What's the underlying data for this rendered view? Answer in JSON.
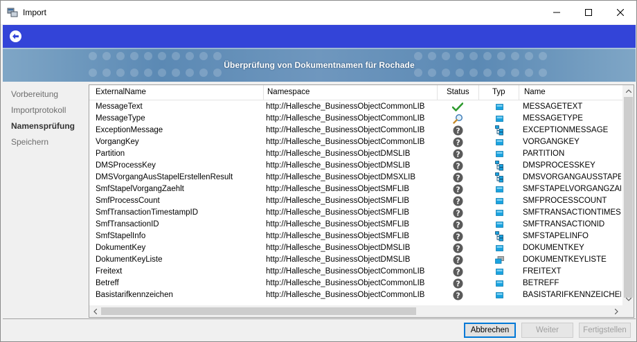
{
  "window": {
    "title": "Import"
  },
  "banner": {
    "title": "Überprüfung von Dokumentnamen für Rochade"
  },
  "nav": {
    "items": [
      {
        "label": "Vorbereitung",
        "active": false
      },
      {
        "label": "Importprotokoll",
        "active": false
      },
      {
        "label": "Namensprüfung",
        "active": true
      },
      {
        "label": "Speichern",
        "active": false
      }
    ]
  },
  "table": {
    "columns": [
      "ExternalName",
      "Namespace",
      "Status",
      "Typ",
      "Name"
    ],
    "rows": [
      {
        "external_name": "MessageText",
        "namespace": "http://Hallesche_BusinessObjectCommonLIB",
        "status": "ok-check",
        "typ": "field",
        "name": "MESSAGETEXT"
      },
      {
        "external_name": "MessageType",
        "namespace": "http://Hallesche_BusinessObjectCommonLIB",
        "status": "search",
        "typ": "field",
        "name": "MESSAGETYPE"
      },
      {
        "external_name": "ExceptionMessage",
        "namespace": "http://Hallesche_BusinessObjectCommonLIB",
        "status": "unknown",
        "typ": "structure",
        "name": "EXCEPTIONMESSAGE"
      },
      {
        "external_name": "VorgangKey",
        "namespace": "http://Hallesche_BusinessObjectCommonLIB",
        "status": "unknown",
        "typ": "field",
        "name": "VORGANGKEY"
      },
      {
        "external_name": "Partition",
        "namespace": "http://Hallesche_BusinessObjectDMSLIB",
        "status": "unknown",
        "typ": "field",
        "name": "PARTITION"
      },
      {
        "external_name": "DMSProcessKey",
        "namespace": "http://Hallesche_BusinessObjectDMSLIB",
        "status": "unknown",
        "typ": "structure",
        "name": "DMSPROCESSKEY"
      },
      {
        "external_name": "DMSVorgangAusStapelErstellenResult",
        "namespace": "http://Hallesche_BusinessObjectDMSXLIB",
        "status": "unknown",
        "typ": "structure",
        "name": "DMSVORGANGAUSSTAPELI"
      },
      {
        "external_name": "SmfStapelVorgangZaehlt",
        "namespace": "http://Hallesche_BusinessObjectSMFLIB",
        "status": "unknown",
        "typ": "field",
        "name": "SMFSTAPELVORGANGZAEH"
      },
      {
        "external_name": "SmfProcessCount",
        "namespace": "http://Hallesche_BusinessObjectSMFLIB",
        "status": "unknown",
        "typ": "field",
        "name": "SMFPROCESSCOUNT"
      },
      {
        "external_name": "SmfTransactionTimestampID",
        "namespace": "http://Hallesche_BusinessObjectSMFLIB",
        "status": "unknown",
        "typ": "field",
        "name": "SMFTRANSACTIONTIMESTA"
      },
      {
        "external_name": "SmfTransactionID",
        "namespace": "http://Hallesche_BusinessObjectSMFLIB",
        "status": "unknown",
        "typ": "field",
        "name": "SMFTRANSACTIONID"
      },
      {
        "external_name": "SmfStapelInfo",
        "namespace": "http://Hallesche_BusinessObjectSMFLIB",
        "status": "unknown",
        "typ": "structure",
        "name": "SMFSTAPELINFO"
      },
      {
        "external_name": "DokumentKey",
        "namespace": "http://Hallesche_BusinessObjectDMSLIB",
        "status": "unknown",
        "typ": "field",
        "name": "DOKUMENTKEY"
      },
      {
        "external_name": "DokumentKeyListe",
        "namespace": "http://Hallesche_BusinessObjectDMSLIB",
        "status": "unknown",
        "typ": "list",
        "name": "DOKUMENTKEYLISTE"
      },
      {
        "external_name": "Freitext",
        "namespace": "http://Hallesche_BusinessObjectCommonLIB",
        "status": "unknown",
        "typ": "field",
        "name": "FREITEXT"
      },
      {
        "external_name": "Betreff",
        "namespace": "http://Hallesche_BusinessObjectCommonLIB",
        "status": "unknown",
        "typ": "field",
        "name": "BETREFF"
      },
      {
        "external_name": "Basistarifkennzeichen",
        "namespace": "http://Hallesche_BusinessObjectCommonLIB",
        "status": "unknown",
        "typ": "field",
        "name": "BASISTARIFKENNZEICHEN"
      }
    ]
  },
  "buttons": {
    "cancel": "Abbrechen",
    "next": "Weiter",
    "finish": "Fertigstellen"
  },
  "colors": {
    "wizard_bar": "#3344d8",
    "banner": "#5b89b4",
    "field_icon": "#1aa3e0",
    "status_unknown": "#5a5a5a",
    "status_ok": "#2e9a2e"
  }
}
